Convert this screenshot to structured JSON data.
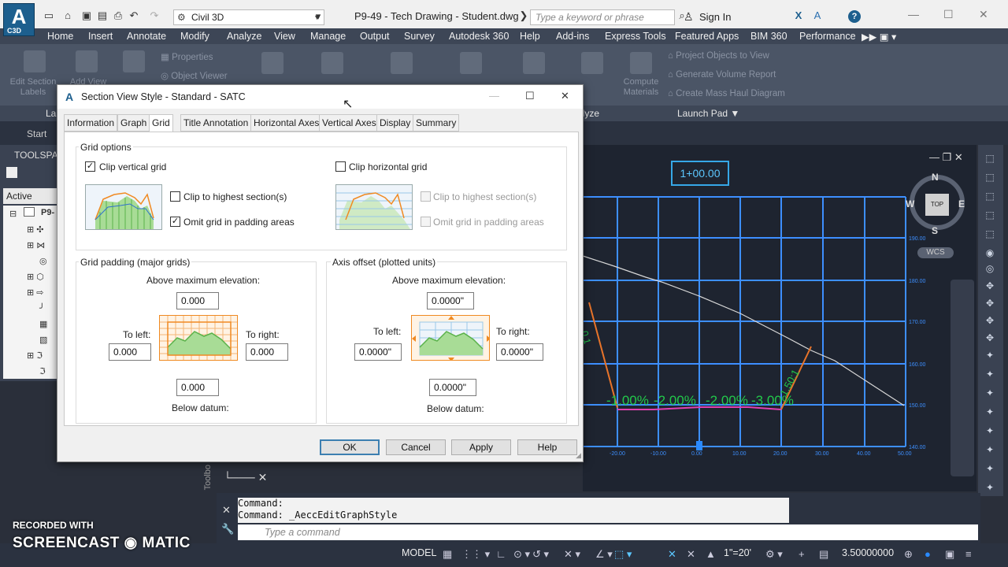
{
  "app": {
    "logo_text": "A",
    "logo_sub": "C3D",
    "workspace": "Civil 3D",
    "document_title": "P9-49 - Tech Drawing - Student.dwg",
    "search_placeholder": "Type a keyword or phrase",
    "sign_in": "Sign In"
  },
  "menu": [
    "Home",
    "Insert",
    "Annotate",
    "Modify",
    "Analyze",
    "View",
    "Manage",
    "Output",
    "Survey",
    "Autodesk 360",
    "Help",
    "Add-ins",
    "Express Tools",
    "Featured Apps",
    "BIM 360",
    "Performance"
  ],
  "ribbon": {
    "edit_section_labels": "Edit Section\nLabels",
    "add_view": "Add View",
    "properties": "Properties",
    "object_viewer": "Object Viewer",
    "compute_materials": "Compute\nMaterials",
    "project_objects": "Project Objects to View",
    "generate_volume": "Generate Volume Report",
    "create_mass_haul": "Create Mass Haul Diagram",
    "panel_la": "La",
    "panel_analyze": "alyze",
    "panel_launch_pad": "Launch Pad"
  },
  "filetabs": {
    "start": "Start"
  },
  "toolspace": {
    "title": "TOOLSPAC",
    "active_drawing": "Active Drawin",
    "tree_root": "P9-"
  },
  "drawing": {
    "station": "1+00.00",
    "compass": {
      "n": "N",
      "s": "S",
      "e": "E",
      "w": "W",
      "top": "TOP"
    },
    "wcs": "WCS",
    "grade_labels": [
      "-1.00%",
      "-2.00%",
      "-2.00%",
      "-3.00%"
    ],
    "slope_left": "0.1",
    "slope_right": "1.50:1",
    "x_ticks": [
      "-20.00",
      "-10.00",
      "0.00",
      "10.00",
      "20.00",
      "30.00",
      "40.00",
      "50.00"
    ],
    "y_ticks": [
      "190.00",
      "180.00",
      "170.00",
      "160.00",
      "150.00",
      "140.00"
    ]
  },
  "command": {
    "history": [
      "Command:",
      "Command:  _AeccEditGraphStyle"
    ],
    "placeholder": "Type a command"
  },
  "status": {
    "model": "MODEL",
    "scale": "1\"=20'",
    "units": "3.50000000"
  },
  "watermark": {
    "line1": "RECORDED WITH",
    "line2": "SCREENCAST ◉ MATIC"
  },
  "toolbox_label": "Toolbo",
  "dialog": {
    "title": "Section View Style - Standard - SATC",
    "tabs": [
      "Information",
      "Graph",
      "Grid",
      "Title Annotation",
      "Horizontal Axes",
      "Vertical Axes",
      "Display",
      "Summary"
    ],
    "active_tab": "Grid",
    "grid_options": {
      "label": "Grid options",
      "clip_vertical": {
        "label": "Clip vertical grid",
        "checked": true
      },
      "clip_highest_v": {
        "label": "Clip to highest section(s)",
        "checked": false
      },
      "omit_padding_v": {
        "label": "Omit grid in padding areas",
        "checked": true
      },
      "clip_horizontal": {
        "label": "Clip horizontal grid",
        "checked": false
      },
      "clip_highest_h": {
        "label": "Clip to highest section(s)",
        "checked": false,
        "disabled": true
      },
      "omit_padding_h": {
        "label": "Omit grid in padding areas",
        "checked": false,
        "disabled": true
      }
    },
    "grid_padding": {
      "label": "Grid padding (major grids)",
      "above_label": "Above maximum elevation:",
      "above_value": "0.000",
      "left_label": "To left:",
      "left_value": "0.000",
      "right_label": "To right:",
      "right_value": "0.000",
      "below_value": "0.000",
      "below_label": "Below datum:"
    },
    "axis_offset": {
      "label": "Axis offset (plotted units)",
      "above_label": "Above maximum elevation:",
      "above_value": "0.0000\"",
      "left_label": "To left:",
      "left_value": "0.0000\"",
      "right_label": "To right:",
      "right_value": "0.0000\"",
      "below_value": "0.0000\"",
      "below_label": "Below datum:"
    },
    "buttons": {
      "ok": "OK",
      "cancel": "Cancel",
      "apply": "Apply",
      "help": "Help"
    }
  },
  "colors": {
    "grid_line": "#3d8fff",
    "ground_line": "#d8d8d8",
    "grade_text": "#22c84a",
    "slope_orange": "#e8742a",
    "design_magenta": "#e040b0",
    "dialog_preview_orange": "#f08a22",
    "dialog_preview_green": "#6cc65a"
  }
}
